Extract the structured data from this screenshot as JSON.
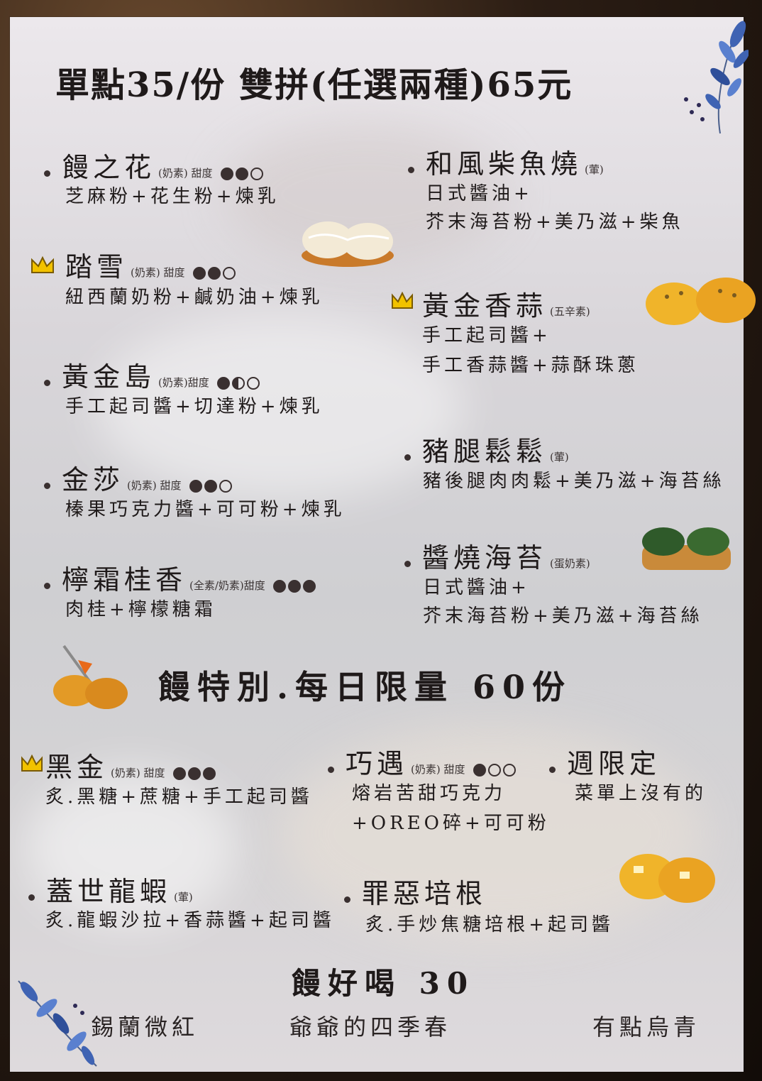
{
  "header": "單點35/份  雙拼(任選兩種)65元",
  "left_items": [
    {
      "name": "饅之花",
      "tag": "(奶素) 甜度",
      "sweetness": [
        "full",
        "full",
        "empty"
      ],
      "desc": [
        "芝麻粉+花生粉+煉乳"
      ]
    },
    {
      "name": "踏雪",
      "tag": "(奶素) 甜度",
      "sweetness": [
        "full",
        "full",
        "empty"
      ],
      "desc": [
        "紐西蘭奶粉+鹹奶油+煉乳"
      ]
    },
    {
      "name": "黃金島",
      "tag": "(奶素)甜度",
      "sweetness": [
        "full",
        "half",
        "empty"
      ],
      "desc": [
        "手工起司醬+切達粉+煉乳"
      ]
    },
    {
      "name": "金莎",
      "tag": "(奶素) 甜度",
      "sweetness": [
        "full",
        "full",
        "empty"
      ],
      "desc": [
        "榛果巧克力醬+可可粉+煉乳"
      ]
    },
    {
      "name": "檸霜桂香",
      "tag": "(全素/奶素)甜度",
      "sweetness": [
        "full",
        "full",
        "full"
      ],
      "desc": [
        "肉桂+檸檬糖霜"
      ]
    }
  ],
  "right_items": [
    {
      "name": "和風柴魚燒",
      "tag": "(葷)",
      "desc": [
        "日式醬油+",
        "芥末海苔粉+美乃滋+柴魚"
      ]
    },
    {
      "name": "黃金香蒜",
      "tag": "(五辛素)",
      "desc": [
        "手工起司醬+",
        "手工香蒜醬+蒜酥珠蔥"
      ]
    },
    {
      "name": "豬腿鬆鬆",
      "tag": "(葷)",
      "desc": [
        "豬後腿肉肉鬆+美乃滋+海苔絲"
      ]
    },
    {
      "name": "醬燒海苔",
      "tag": "(蛋奶素)",
      "desc": [
        "日式醬油+",
        "芥末海苔粉+美乃滋+海苔絲"
      ]
    }
  ],
  "special": {
    "title": "饅特別.每日限量  60份",
    "items": [
      {
        "name": "黑金",
        "tag": "(奶素) 甜度",
        "sweetness": [
          "full",
          "full",
          "full"
        ],
        "desc": [
          "炙.黑糖+蔗糖+手工起司醬"
        ]
      },
      {
        "name": "巧遇",
        "tag": "(奶素) 甜度",
        "sweetness": [
          "full",
          "empty",
          "empty"
        ],
        "desc": [
          "熔岩苦甜巧克力",
          "+OREO碎+可可粉"
        ]
      },
      {
        "name": "週限定",
        "desc": [
          "菜單上沒有的"
        ]
      },
      {
        "name": "蓋世龍蝦",
        "tag": "(葷)",
        "desc": [
          "炙.龍蝦沙拉+香蒜醬+起司醬"
        ]
      },
      {
        "name": "罪惡培根",
        "desc": [
          "炙.手炒焦糖培根+起司醬"
        ]
      }
    ]
  },
  "drinks": {
    "title": "饅好喝 30",
    "items": [
      "錫蘭微紅",
      "爺爺的四季春",
      "有點烏青"
    ]
  },
  "icons": {
    "crown": "crown-icon",
    "branch": "leaf-branch-icon",
    "takoyaki": "takoyaki-illustration"
  },
  "colors": {
    "ink": "#1f1a1a",
    "crown": "#f2c200",
    "leaf": "#3f63b3"
  }
}
